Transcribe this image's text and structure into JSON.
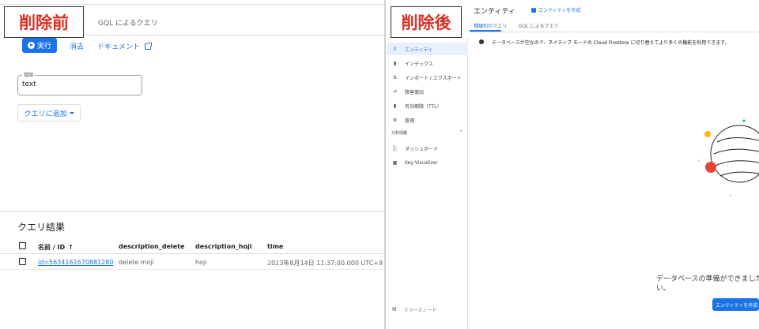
{
  "labels": {
    "before": "削除前",
    "after": "削除後"
  },
  "before_panel": {
    "gql_tab": "GQL によるクエリ",
    "toolbar": {
      "run": "実行",
      "clear": "消去",
      "docs": "ドキュメント"
    },
    "kind_field": {
      "label": "種類",
      "value": "text"
    },
    "add_query": "クエリに追加",
    "results": {
      "title": "クエリ結果",
      "columns": [
        "名前 / ID",
        "description_delete",
        "description_hoji",
        "time"
      ],
      "rows": [
        {
          "id": "id=5634161670881280",
          "description_delete": "delete moji",
          "description_hoji": "hoji",
          "time": "2023年8月14日 11:37:00.000 UTC+9"
        }
      ]
    }
  },
  "after_panel": {
    "title": "エンティティ",
    "create_entity_link": "エンティティを作成",
    "subtabs": [
      "種類別のクエリ",
      "GQL によるクエリ"
    ],
    "sidebar": {
      "items": [
        "エンティティ",
        "インデックス",
        "インポート / エクスポート",
        "障害復旧",
        "有効期限（TTL）",
        "管理"
      ],
      "section": "分析情報",
      "section_items": [
        "ダッシュボード",
        "Key Visualizer"
      ],
      "release_notes": "リリースノート"
    },
    "info_message": "データベースが空なので、ネイティブ モードの Cloud Firestore に切り替えてより多くの機能を利用できます。",
    "ready_text": [
      "データベースの準備ができました。デ",
      "い。"
    ],
    "create_button": "エンティティを作成"
  },
  "colors": {
    "accent": "#1a73e8",
    "label_red": "#d93025"
  }
}
